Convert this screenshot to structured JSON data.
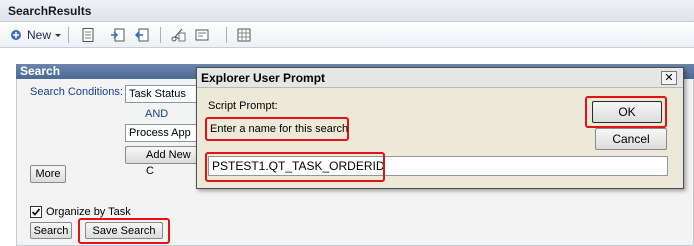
{
  "header": {
    "title": "SearchResults"
  },
  "toolbar": {
    "new_label": "New"
  },
  "search": {
    "title": "Search",
    "conditions_label": "Search Conditions:",
    "field1": "Task Status",
    "and_label": "AND",
    "field2": "Process App",
    "add_new_label": "Add New C",
    "more_label": "More",
    "organize_label": "Organize by Task",
    "search_label": "Search",
    "save_search_label": "Save Search"
  },
  "dialog": {
    "title": "Explorer User Prompt",
    "close_glyph": "✕",
    "script_prompt_label": "Script Prompt:",
    "prompt_text": "Enter a name for this search",
    "input_value": "PSTEST1.QT_TASK_ORDERID",
    "ok_label": "OK",
    "cancel_label": "Cancel"
  },
  "colors": {
    "highlight": "#e01414",
    "panel_header": "#4c6a96"
  }
}
